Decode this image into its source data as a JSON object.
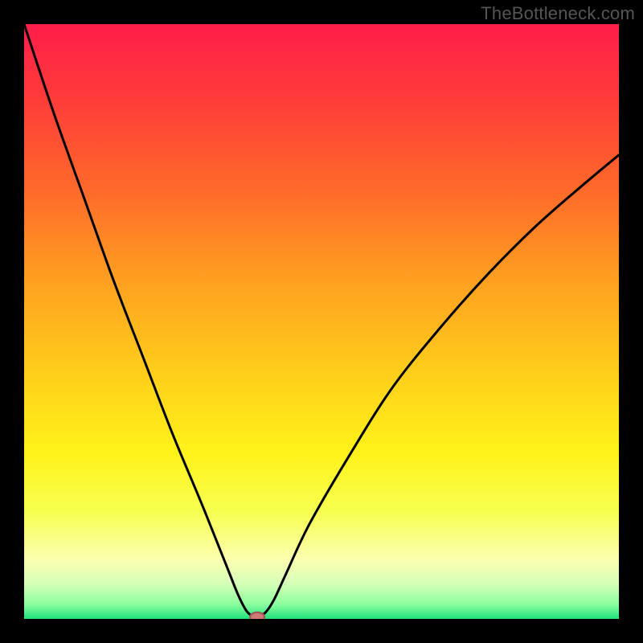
{
  "watermark": "TheBottleneck.com",
  "colors": {
    "black": "#000000",
    "curve": "#000000",
    "marker_fill": "#cf7a78",
    "marker_stroke": "#9f5a57",
    "gradient_stops": [
      {
        "offset": 0.0,
        "color": "#ff1e4a"
      },
      {
        "offset": 0.12,
        "color": "#ff3a3a"
      },
      {
        "offset": 0.28,
        "color": "#ff6a2a"
      },
      {
        "offset": 0.45,
        "color": "#ffa61f"
      },
      {
        "offset": 0.6,
        "color": "#ffd21a"
      },
      {
        "offset": 0.72,
        "color": "#fff21a"
      },
      {
        "offset": 0.82,
        "color": "#f6ff50"
      },
      {
        "offset": 0.9,
        "color": "#fcffb0"
      },
      {
        "offset": 0.94,
        "color": "#d7ffb8"
      },
      {
        "offset": 0.975,
        "color": "#8effa0"
      },
      {
        "offset": 1.0,
        "color": "#22e07a"
      }
    ]
  },
  "chart_data": {
    "type": "line",
    "title": "",
    "xlabel": "",
    "ylabel": "",
    "xlim": [
      0,
      100
    ],
    "ylim": [
      0,
      100
    ],
    "note": "V-shaped bottleneck curve. x is a nominal 0–100 horizontal position; y is distance from optimal (0 = best, 100 = worst). Minimum near x≈39. Values estimated from pixels.",
    "series": [
      {
        "name": "bottleneck-curve",
        "x": [
          0,
          5,
          10,
          15,
          20,
          25,
          30,
          34,
          36,
          37.5,
          39,
          40.5,
          42,
          44,
          48,
          55,
          62,
          70,
          78,
          86,
          94,
          100
        ],
        "y": [
          100,
          85,
          71,
          57,
          44,
          31,
          19,
          9,
          4,
          1.2,
          0.3,
          1.0,
          3.2,
          7.5,
          16,
          28,
          39,
          49,
          58,
          66,
          73,
          78
        ]
      }
    ],
    "marker": {
      "x": 39.2,
      "y": 0.3
    },
    "background": "vertical-gradient-red-to-green"
  }
}
